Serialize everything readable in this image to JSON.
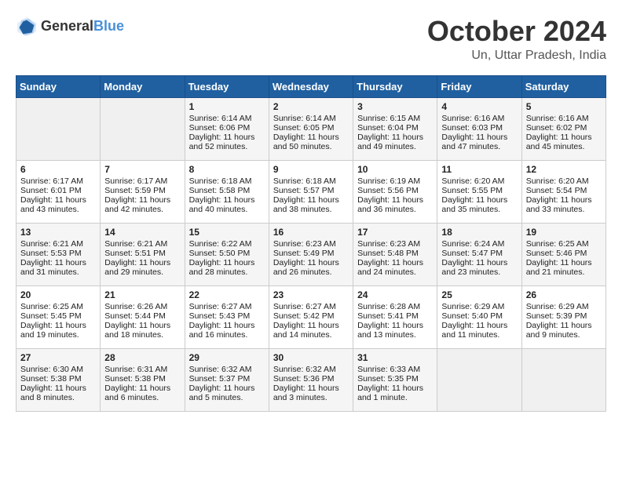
{
  "logo": {
    "general": "General",
    "blue": "Blue"
  },
  "title": {
    "month_year": "October 2024",
    "location": "Un, Uttar Pradesh, India"
  },
  "headers": [
    "Sunday",
    "Monday",
    "Tuesday",
    "Wednesday",
    "Thursday",
    "Friday",
    "Saturday"
  ],
  "weeks": [
    [
      {
        "day": "",
        "empty": true
      },
      {
        "day": "",
        "empty": true
      },
      {
        "day": "1",
        "sunrise": "Sunrise: 6:14 AM",
        "sunset": "Sunset: 6:06 PM",
        "daylight": "Daylight: 11 hours and 52 minutes."
      },
      {
        "day": "2",
        "sunrise": "Sunrise: 6:14 AM",
        "sunset": "Sunset: 6:05 PM",
        "daylight": "Daylight: 11 hours and 50 minutes."
      },
      {
        "day": "3",
        "sunrise": "Sunrise: 6:15 AM",
        "sunset": "Sunset: 6:04 PM",
        "daylight": "Daylight: 11 hours and 49 minutes."
      },
      {
        "day": "4",
        "sunrise": "Sunrise: 6:16 AM",
        "sunset": "Sunset: 6:03 PM",
        "daylight": "Daylight: 11 hours and 47 minutes."
      },
      {
        "day": "5",
        "sunrise": "Sunrise: 6:16 AM",
        "sunset": "Sunset: 6:02 PM",
        "daylight": "Daylight: 11 hours and 45 minutes."
      }
    ],
    [
      {
        "day": "6",
        "sunrise": "Sunrise: 6:17 AM",
        "sunset": "Sunset: 6:01 PM",
        "daylight": "Daylight: 11 hours and 43 minutes."
      },
      {
        "day": "7",
        "sunrise": "Sunrise: 6:17 AM",
        "sunset": "Sunset: 5:59 PM",
        "daylight": "Daylight: 11 hours and 42 minutes."
      },
      {
        "day": "8",
        "sunrise": "Sunrise: 6:18 AM",
        "sunset": "Sunset: 5:58 PM",
        "daylight": "Daylight: 11 hours and 40 minutes."
      },
      {
        "day": "9",
        "sunrise": "Sunrise: 6:18 AM",
        "sunset": "Sunset: 5:57 PM",
        "daylight": "Daylight: 11 hours and 38 minutes."
      },
      {
        "day": "10",
        "sunrise": "Sunrise: 6:19 AM",
        "sunset": "Sunset: 5:56 PM",
        "daylight": "Daylight: 11 hours and 36 minutes."
      },
      {
        "day": "11",
        "sunrise": "Sunrise: 6:20 AM",
        "sunset": "Sunset: 5:55 PM",
        "daylight": "Daylight: 11 hours and 35 minutes."
      },
      {
        "day": "12",
        "sunrise": "Sunrise: 6:20 AM",
        "sunset": "Sunset: 5:54 PM",
        "daylight": "Daylight: 11 hours and 33 minutes."
      }
    ],
    [
      {
        "day": "13",
        "sunrise": "Sunrise: 6:21 AM",
        "sunset": "Sunset: 5:53 PM",
        "daylight": "Daylight: 11 hours and 31 minutes."
      },
      {
        "day": "14",
        "sunrise": "Sunrise: 6:21 AM",
        "sunset": "Sunset: 5:51 PM",
        "daylight": "Daylight: 11 hours and 29 minutes."
      },
      {
        "day": "15",
        "sunrise": "Sunrise: 6:22 AM",
        "sunset": "Sunset: 5:50 PM",
        "daylight": "Daylight: 11 hours and 28 minutes."
      },
      {
        "day": "16",
        "sunrise": "Sunrise: 6:23 AM",
        "sunset": "Sunset: 5:49 PM",
        "daylight": "Daylight: 11 hours and 26 minutes."
      },
      {
        "day": "17",
        "sunrise": "Sunrise: 6:23 AM",
        "sunset": "Sunset: 5:48 PM",
        "daylight": "Daylight: 11 hours and 24 minutes."
      },
      {
        "day": "18",
        "sunrise": "Sunrise: 6:24 AM",
        "sunset": "Sunset: 5:47 PM",
        "daylight": "Daylight: 11 hours and 23 minutes."
      },
      {
        "day": "19",
        "sunrise": "Sunrise: 6:25 AM",
        "sunset": "Sunset: 5:46 PM",
        "daylight": "Daylight: 11 hours and 21 minutes."
      }
    ],
    [
      {
        "day": "20",
        "sunrise": "Sunrise: 6:25 AM",
        "sunset": "Sunset: 5:45 PM",
        "daylight": "Daylight: 11 hours and 19 minutes."
      },
      {
        "day": "21",
        "sunrise": "Sunrise: 6:26 AM",
        "sunset": "Sunset: 5:44 PM",
        "daylight": "Daylight: 11 hours and 18 minutes."
      },
      {
        "day": "22",
        "sunrise": "Sunrise: 6:27 AM",
        "sunset": "Sunset: 5:43 PM",
        "daylight": "Daylight: 11 hours and 16 minutes."
      },
      {
        "day": "23",
        "sunrise": "Sunrise: 6:27 AM",
        "sunset": "Sunset: 5:42 PM",
        "daylight": "Daylight: 11 hours and 14 minutes."
      },
      {
        "day": "24",
        "sunrise": "Sunrise: 6:28 AM",
        "sunset": "Sunset: 5:41 PM",
        "daylight": "Daylight: 11 hours and 13 minutes."
      },
      {
        "day": "25",
        "sunrise": "Sunrise: 6:29 AM",
        "sunset": "Sunset: 5:40 PM",
        "daylight": "Daylight: 11 hours and 11 minutes."
      },
      {
        "day": "26",
        "sunrise": "Sunrise: 6:29 AM",
        "sunset": "Sunset: 5:39 PM",
        "daylight": "Daylight: 11 hours and 9 minutes."
      }
    ],
    [
      {
        "day": "27",
        "sunrise": "Sunrise: 6:30 AM",
        "sunset": "Sunset: 5:38 PM",
        "daylight": "Daylight: 11 hours and 8 minutes."
      },
      {
        "day": "28",
        "sunrise": "Sunrise: 6:31 AM",
        "sunset": "Sunset: 5:38 PM",
        "daylight": "Daylight: 11 hours and 6 minutes."
      },
      {
        "day": "29",
        "sunrise": "Sunrise: 6:32 AM",
        "sunset": "Sunset: 5:37 PM",
        "daylight": "Daylight: 11 hours and 5 minutes."
      },
      {
        "day": "30",
        "sunrise": "Sunrise: 6:32 AM",
        "sunset": "Sunset: 5:36 PM",
        "daylight": "Daylight: 11 hours and 3 minutes."
      },
      {
        "day": "31",
        "sunrise": "Sunrise: 6:33 AM",
        "sunset": "Sunset: 5:35 PM",
        "daylight": "Daylight: 11 hours and 1 minute."
      },
      {
        "day": "",
        "empty": true
      },
      {
        "day": "",
        "empty": true
      }
    ]
  ]
}
